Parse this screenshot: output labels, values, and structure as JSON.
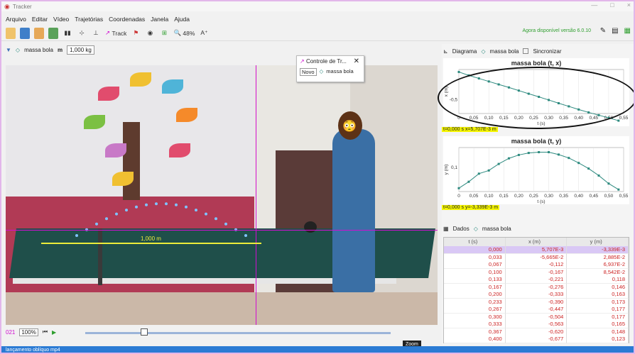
{
  "window": {
    "title": "Tracker",
    "min": "—",
    "max": "□",
    "close": "×"
  },
  "menu": [
    "Arquivo",
    "Editar",
    "Vídeo",
    "Trajetórias",
    "Coordenadas",
    "Janela",
    "Ajuda"
  ],
  "toolbar": {
    "track_label": "Track",
    "zoom_label": "48%",
    "font_label": "A⁺",
    "available": "Agora disponível versão 6.0.10"
  },
  "trackbar": {
    "track_name": "massa bola",
    "m_label": "m",
    "mass_value": "1,000 kg"
  },
  "popup": {
    "title": "Controle de Tr...",
    "novo": "Novo",
    "track": "massa bola"
  },
  "video": {
    "length_label": "1,000 m"
  },
  "playbar": {
    "frame": "021",
    "rate": "100%",
    "tooltip": "Zoom"
  },
  "status": "lançamento oblíquo mp4",
  "right_panel": {
    "diagram_label": "Diagrama",
    "track": "massa bola",
    "sync_label": "Sincronizar",
    "readout1": "t=0,000 s  x=5,707E-3 m",
    "readout2": "t=0,000 s  y=-3,339E-3 m",
    "data_label": "Dados",
    "table_track": "massa bola"
  },
  "colors": {
    "accent": "#d10ed1",
    "plot_line": "#2d8a7f",
    "readout": "#f5f500",
    "status": "#2b7bd4"
  },
  "chart_data": [
    {
      "type": "line",
      "title": "massa bola (t, x)",
      "xlabel": "t (s)",
      "ylabel": "x (m)",
      "xlim": [
        0,
        0.55
      ],
      "ylim": [
        -0.75,
        0.05
      ],
      "x_ticks": [
        "0",
        "0,05",
        "0,10",
        "0,15",
        "0,20",
        "0,25",
        "0,30",
        "0,35",
        "0,40",
        "0,45",
        "0,50",
        "0,55"
      ],
      "y_ticks": [
        "-0,5"
      ],
      "x": [
        0,
        0.033,
        0.067,
        0.1,
        0.133,
        0.167,
        0.2,
        0.233,
        0.267,
        0.3,
        0.333,
        0.367,
        0.4,
        0.433,
        0.467,
        0.5,
        0.533
      ],
      "values": [
        0.0057,
        -0.0567,
        -0.112,
        -0.167,
        -0.221,
        -0.276,
        -0.333,
        -0.39,
        -0.447,
        -0.504,
        -0.563,
        -0.62,
        -0.677,
        -0.73,
        -0.78,
        -0.83,
        -0.88
      ]
    },
    {
      "type": "line",
      "title": "massa bola (t, y)",
      "xlabel": "t (s)",
      "ylabel": "y (m)",
      "xlim": [
        0,
        0.55
      ],
      "ylim": [
        -0.02,
        0.2
      ],
      "x_ticks": [
        "0",
        "0,05",
        "0,10",
        "0,15",
        "0,20",
        "0,25",
        "0,30",
        "0,35",
        "0,40",
        "0,45",
        "0,50",
        "0,55"
      ],
      "y_ticks": [
        "0,1"
      ],
      "x": [
        0,
        0.033,
        0.067,
        0.1,
        0.133,
        0.167,
        0.2,
        0.233,
        0.267,
        0.3,
        0.333,
        0.367,
        0.4,
        0.433,
        0.467,
        0.5,
        0.533
      ],
      "values": [
        -0.0033,
        0.0289,
        0.0694,
        0.0854,
        0.118,
        0.146,
        0.163,
        0.173,
        0.177,
        0.177,
        0.165,
        0.148,
        0.123,
        0.095,
        0.06,
        0.02,
        -0.01
      ]
    }
  ],
  "table": {
    "headers": [
      "t (s)",
      "x (m)",
      "y (m)"
    ],
    "rows": [
      [
        "0,000",
        "5,707E-3",
        "-3,339E-3"
      ],
      [
        "0,033",
        "-5,665E-2",
        "2,885E-2"
      ],
      [
        "0,067",
        "-0,112",
        "6,937E-2"
      ],
      [
        "0,100",
        "-0,167",
        "8,542E-2"
      ],
      [
        "0,133",
        "-0,221",
        "0,118"
      ],
      [
        "0,167",
        "-0,276",
        "0,146"
      ],
      [
        "0,200",
        "-0,333",
        "0,163"
      ],
      [
        "0,233",
        "-0,390",
        "0,173"
      ],
      [
        "0,267",
        "-0,447",
        "0,177"
      ],
      [
        "0,300",
        "-0,504",
        "0,177"
      ],
      [
        "0,333",
        "-0,563",
        "0,165"
      ],
      [
        "0,367",
        "-0,620",
        "0,148"
      ],
      [
        "0,400",
        "-0,677",
        "0,123"
      ]
    ]
  }
}
